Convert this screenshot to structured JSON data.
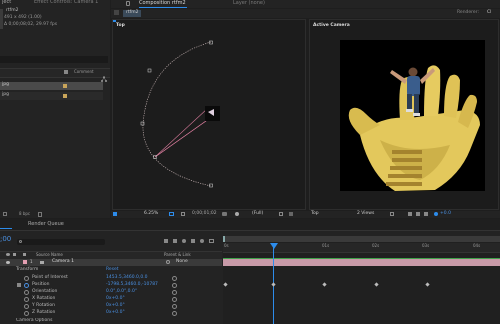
{
  "project": {
    "tab_project": "ject",
    "tab_effects": "Effect Controls: Camera 1",
    "item_name": "rtfm2",
    "item_info1": "491 x 492 (1.00)",
    "item_info2": "Δ 0;00;08;02, 29.97 fps",
    "col_label_header": "",
    "col_comment": "Comment",
    "row1": "jpg",
    "row2": "jpg",
    "bpc": "8 bpc"
  },
  "comp_panel": {
    "tab_comp": "Composition rtfm2",
    "tab_layer": "Layer (none)",
    "breadcrumb": "rtfm2",
    "renderer_label": "Renderer:",
    "renderer_value": "Cl",
    "left_view_label": "Top",
    "right_view_label": "Active Camera",
    "zoom": "6.25%",
    "timecode": "0;00;01;02",
    "resolution": "(Full)",
    "view_select": "Top",
    "views_select": "2 Views",
    "offset": "+0.0"
  },
  "render_queue": {
    "tab_label": "Render Queue"
  },
  "timeline": {
    "current_time": ";00",
    "search_placeholder": "",
    "col_layer_name": "Source Name",
    "col_parent": "Parent & Link",
    "layer_number": "1",
    "layer_name": "Camera 1",
    "parent_value": "None",
    "transform_label": "Transform",
    "reset_label": "Reset",
    "properties": [
      {
        "name": "Point of Interest",
        "value": "1453.5,3460.0,0.0"
      },
      {
        "name": "Position",
        "value": "-1798.5,3460.0,-10787"
      },
      {
        "name": "Orientation",
        "value": "0.0°,0.0°,0.0°"
      },
      {
        "name": "X Rotation",
        "value": "0x+0.0°"
      },
      {
        "name": "Y Rotation",
        "value": "0x+0.0°"
      },
      {
        "name": "Z Rotation",
        "value": "0x+0.0°"
      }
    ],
    "camera_options": "Camera Options",
    "ruler_labels": [
      "0s",
      "01s",
      "02s",
      "03s",
      "04s",
      "05s"
    ]
  }
}
